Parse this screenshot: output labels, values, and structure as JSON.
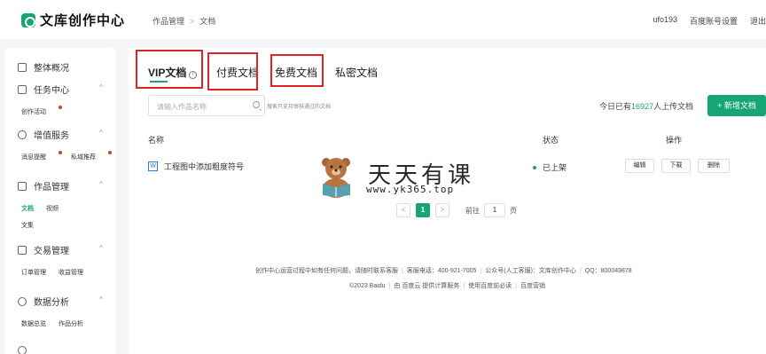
{
  "header": {
    "logo_text": "文库创作中心",
    "breadcrumb": [
      "作品管理",
      "文档"
    ],
    "breadcrumb_sep": ">",
    "user_name": "ufo193",
    "account_settings": "百度账号设置",
    "logout": "退出"
  },
  "sidebar": {
    "groups": [
      {
        "label": "整体概况",
        "icon": "home-icon",
        "items": []
      },
      {
        "label": "任务中心",
        "icon": "task-icon",
        "items": [
          {
            "label": "创作活动",
            "badge": true
          }
        ]
      },
      {
        "label": "增值服务",
        "icon": "heart-icon",
        "items": [
          {
            "label": "消息提醒",
            "badge": true
          },
          {
            "label": "私域推荐",
            "badge": true
          }
        ]
      },
      {
        "label": "作品管理",
        "icon": "layers-icon",
        "items": [
          {
            "label": "文档",
            "active": true
          },
          {
            "label": "视频"
          },
          {
            "label": "文集"
          }
        ]
      },
      {
        "label": "交易管理",
        "icon": "trade-icon",
        "items": [
          {
            "label": "订单管理"
          },
          {
            "label": "收益管理"
          }
        ]
      },
      {
        "label": "数据分析",
        "icon": "chart-icon",
        "items": [
          {
            "label": "数据总览"
          },
          {
            "label": "作品分析"
          }
        ]
      },
      {
        "label": "",
        "icon": "more-icon",
        "items": []
      }
    ]
  },
  "tabs": [
    {
      "label": "VIP文档",
      "active": true,
      "info_icon": "ⓘ"
    },
    {
      "label": "付费文档"
    },
    {
      "label": "免费文档"
    },
    {
      "label": "私密文档"
    }
  ],
  "search": {
    "placeholder": "请输入作品名称",
    "hint": "搜索只支持审核通过的文档"
  },
  "upload_count": {
    "prefix": "今日已有",
    "count": "16927",
    "suffix": "人上传文档"
  },
  "new_button": "+ 新增文档",
  "table": {
    "columns": [
      "名称",
      "状态",
      "操作"
    ],
    "rows": [
      {
        "file_type": "W",
        "name": "工程图中添加粗度符号",
        "status": "已上架",
        "actions": [
          "编辑",
          "下载",
          "删除"
        ]
      }
    ]
  },
  "pagination": {
    "prev": "<",
    "current": "1",
    "next": ">",
    "goto_label": "前往",
    "goto_value": "1",
    "page_unit": "页"
  },
  "footer": {
    "line1": [
      "创作中心运营过程中如有任何问题，请随时联系客服",
      "客服电话：400-921-7005",
      "公众号(人工客服)：文库创作中心",
      "QQ：800049878"
    ],
    "line2": [
      "©2023 Baidu",
      "由 百度云 提供计算服务",
      "使用百度前必读",
      "百度营销"
    ]
  },
  "watermark": {
    "title": "天天有课",
    "url": "www.yk365.top"
  },
  "colors": {
    "accent": "#17a673",
    "highlight_box": "#e02424",
    "word_blue": "#2f78d6"
  }
}
